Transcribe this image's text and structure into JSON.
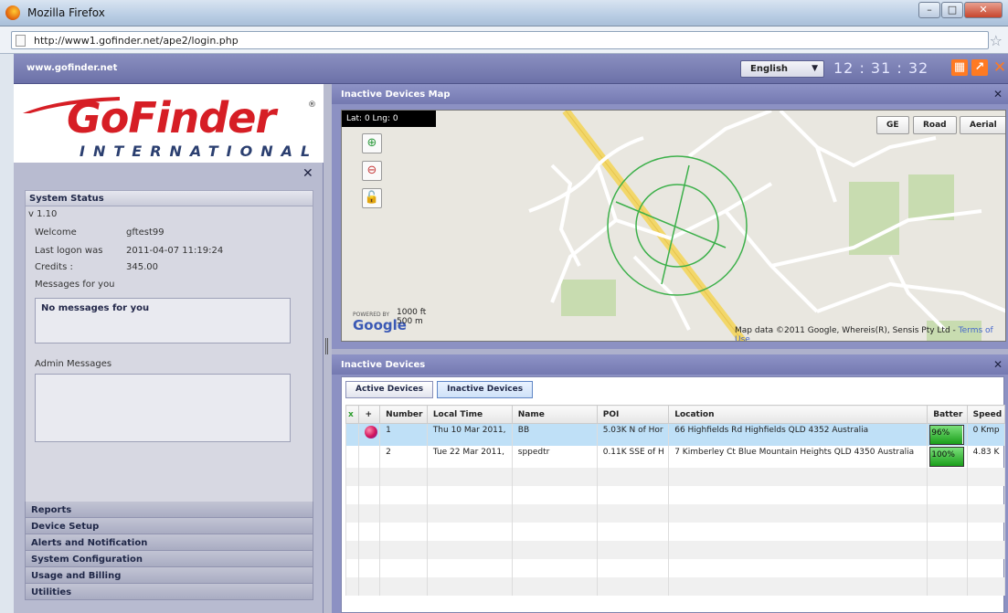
{
  "browser": {
    "title": "Mozilla Firefox",
    "url": "http://www1.gofinder.net/ape2/login.php"
  },
  "header": {
    "site": "www.gofinder.net",
    "language": "English",
    "clock": "12 : 31 : 32"
  },
  "logo": {
    "brand": "GoFinder",
    "registered": "®",
    "tagline": "INTERNATIONAL"
  },
  "system_status": {
    "title": "System Status",
    "version": "v 1.10",
    "welcome_label": "Welcome",
    "welcome_value": "gftest99",
    "last_logon_label": "Last logon was",
    "last_logon_value": "2011-04-07 11:19:24",
    "credits_label": "Credits :",
    "credits_value": "345.00",
    "messages_label": "Messages for you",
    "messages_text": "No messages for you",
    "admin_label": "Admin Messages"
  },
  "menu": [
    {
      "label": "Reports"
    },
    {
      "label": "Device Setup"
    },
    {
      "label": "Alerts and Notification"
    },
    {
      "label": "System Configuration"
    },
    {
      "label": "Usage and Billing"
    },
    {
      "label": "Utilities"
    }
  ],
  "map": {
    "title": "Inactive Devices Map",
    "latlng": "Lat: 0   Lng: 0",
    "tabs": [
      "GE",
      "Road",
      "Aerial"
    ],
    "scale_ft": "1000 ft",
    "scale_m": "500 m",
    "powered_by": "POWERED BY",
    "google": "Google",
    "credit": "Map data ©2011  Google, Whereis(R), Sensis Pty Ltd - ",
    "terms": "Terms of Use"
  },
  "devices": {
    "title": "Inactive Devices",
    "tabs": [
      "Active Devices",
      "Inactive Devices"
    ],
    "columns": [
      "x",
      "+",
      "Number",
      "Local Time",
      "Name",
      "POI",
      "Location",
      "Batter",
      "Speed"
    ],
    "rows": [
      {
        "number": "1",
        "time": "Thu 10 Mar 2011,",
        "name": "BB",
        "poi": "5.03K N of Hor",
        "location": "66 Highfields Rd Highfields QLD 4352 Australia",
        "battery": "96%",
        "battery_level": 0.96,
        "speed": "0 Kmp"
      },
      {
        "number": "2",
        "time": "Tue 22 Mar 2011,",
        "name": "sppedtr",
        "poi": "0.11K SSE of H",
        "location": "7 Kimberley Ct Blue Mountain Heights QLD 4350 Australia",
        "battery": "100%",
        "battery_level": 1.0,
        "speed": "4.83 K"
      }
    ]
  }
}
